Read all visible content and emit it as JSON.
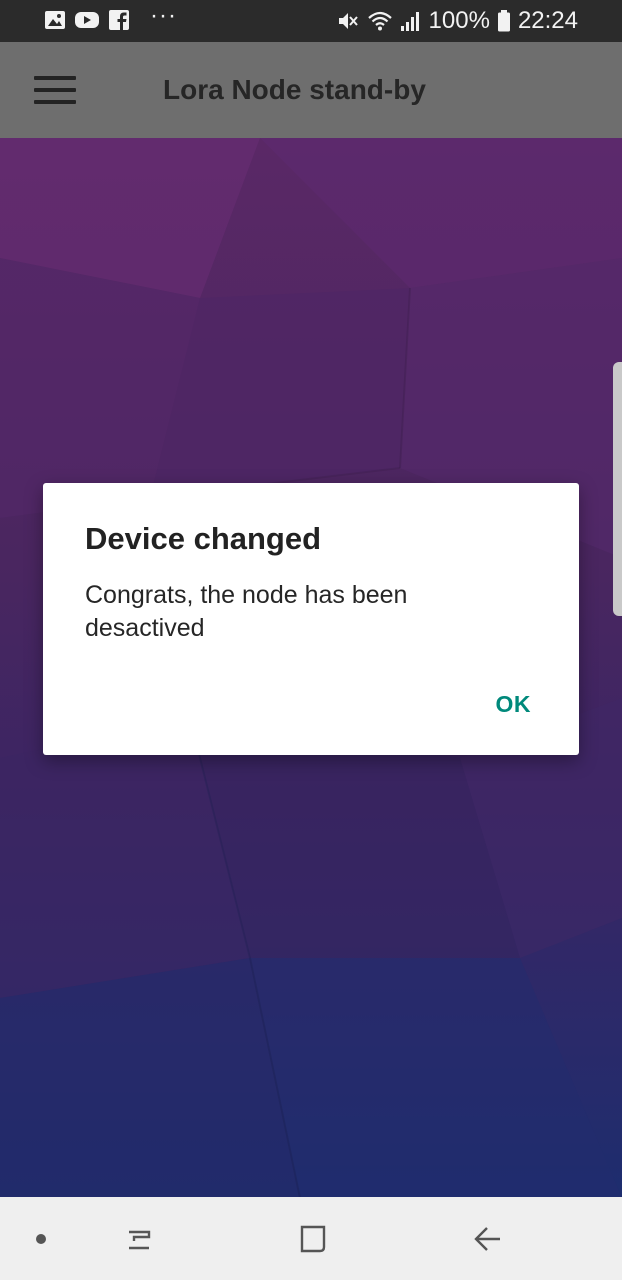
{
  "status_bar": {
    "left_icons": [
      "gallery-icon",
      "youtube-icon",
      "facebook-icon"
    ],
    "more_notifications": "···",
    "right_icons": [
      "mute-icon",
      "wifi-icon",
      "signal-icon"
    ],
    "battery_percent": "100%",
    "time": "22:24"
  },
  "toolbar": {
    "menu_icon": "hamburger-menu-icon",
    "title": "Lora Node stand-by"
  },
  "dialog": {
    "title": "Device changed",
    "message": "Congrats, the node has been desactived",
    "ok_label": "OK",
    "ok_color": "#00897b"
  },
  "nav_bar": {
    "items": [
      "dot-icon",
      "recent-apps-icon",
      "home-icon",
      "back-icon"
    ]
  },
  "colors": {
    "status_bar_bg": "#2b2b2b",
    "toolbar_bg_dimmed": "#6e6e6e",
    "background_top": "#5a2866",
    "background_bottom": "#1d2d6e",
    "nav_bar_bg": "#efefef"
  }
}
